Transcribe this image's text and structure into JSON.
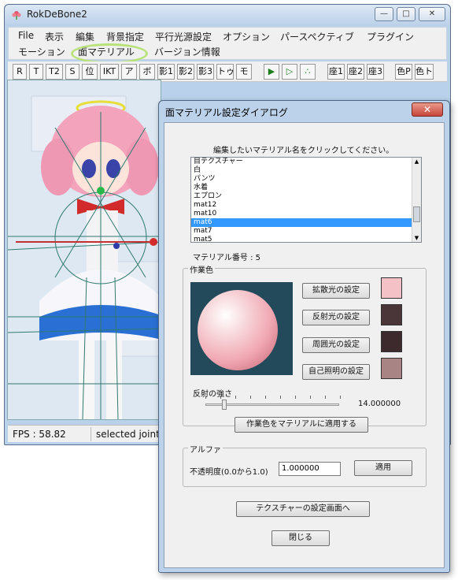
{
  "main_window": {
    "title": "RokDeBone2",
    "menu_row1": [
      "File",
      "表示",
      "編集",
      "背景指定",
      "平行光源設定",
      "オプション",
      "パースペクティブ",
      "プラグイン"
    ],
    "menu_row2": [
      "モーション",
      "面マテリアル",
      "バージョン情報"
    ],
    "toolbar": [
      "R",
      "T",
      "T2",
      "S",
      "位",
      "IKT",
      "ア",
      "ボ",
      "影1",
      "影2",
      "影3",
      "トゥ",
      "モ",
      "▶",
      "▷",
      "∴",
      "座1",
      "座2",
      "座3",
      "色P",
      "色ト"
    ],
    "status": {
      "fps": "FPS : 58.82",
      "selected": "selected joint p"
    }
  },
  "dialog": {
    "title": "面マテリアル設定ダイアログ",
    "close_label": "✕",
    "instruction": "編集したいマテリアル名をクリックしてください。",
    "materials": [
      "目テクスチャー",
      "白",
      "パンツ",
      "水着",
      "エプロン",
      "mat12",
      "mat10",
      "mat6",
      "mat7",
      "mat5"
    ],
    "selected_index": 7,
    "material_number_label": "マテリアル番号 : 5",
    "work_color": {
      "group_title": "作業色",
      "diffuse_button": "拡散光の設定",
      "specular_button": "反射光の設定",
      "ambient_button": "周囲光の設定",
      "emissive_button": "自己照明の設定",
      "colors": {
        "diffuse": "#f4c1c6",
        "specular": "#4a3538",
        "ambient": "#3d2a2d",
        "emissive": "#a98484"
      },
      "reflect_label": "反射の強さ",
      "reflect_value": "14.000000",
      "reflect_fraction": 0.14,
      "apply_button": "作業色をマテリアルに適用する"
    },
    "alpha": {
      "group_title": "アルファ",
      "opacity_label": "不透明度(0.0から1.0)",
      "value": "1.000000",
      "apply_button": "適用"
    },
    "texture_button": "テクスチャーの設定画面へ",
    "close_button": "閉じる"
  }
}
